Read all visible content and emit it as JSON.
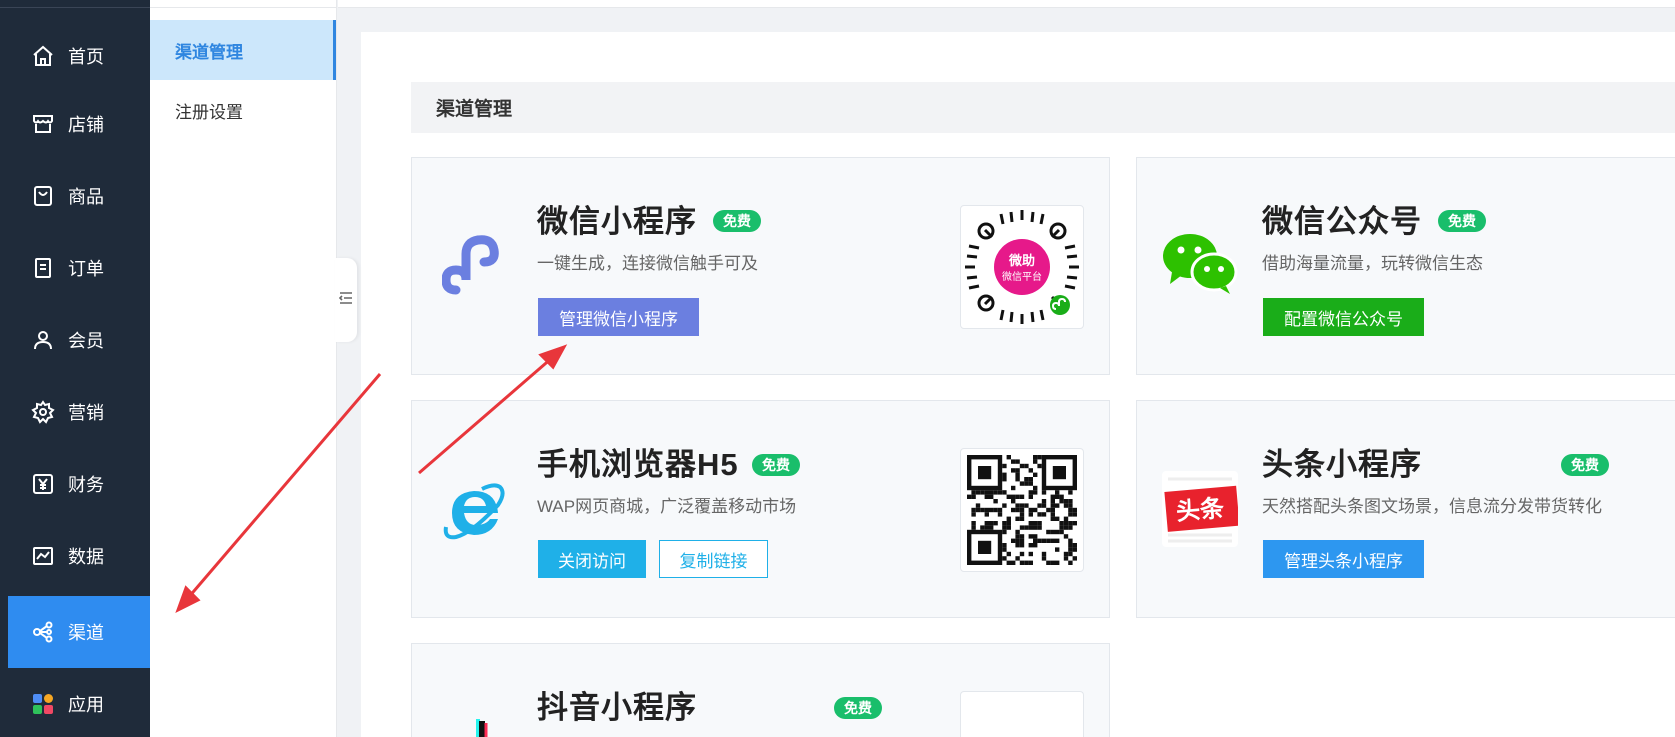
{
  "nav": {
    "items": [
      {
        "label": "首页",
        "icon": "home-icon"
      },
      {
        "label": "店铺",
        "icon": "store-icon"
      },
      {
        "label": "商品",
        "icon": "bag-icon"
      },
      {
        "label": "订单",
        "icon": "order-icon"
      },
      {
        "label": "会员",
        "icon": "user-icon"
      },
      {
        "label": "营销",
        "icon": "gear-icon"
      },
      {
        "label": "财务",
        "icon": "yen-icon"
      },
      {
        "label": "数据",
        "icon": "chart-icon"
      },
      {
        "label": "渠道",
        "icon": "share-icon"
      },
      {
        "label": "应用",
        "icon": "apps-icon"
      }
    ],
    "active": "渠道"
  },
  "subnav": {
    "items": [
      {
        "label": "渠道管理"
      },
      {
        "label": "注册设置"
      }
    ],
    "active": "渠道管理"
  },
  "section": {
    "title": "渠道管理"
  },
  "channels": [
    {
      "title": "微信小程序",
      "badge": "免费",
      "desc": "一键生成，连接微信触手可及",
      "buttons": [
        "管理微信小程序"
      ],
      "qr_text": [
        "微助",
        "微信平台"
      ]
    },
    {
      "title": "微信公众号",
      "badge": "免费",
      "desc": "借助海量流量，玩转微信生态",
      "buttons": [
        "配置微信公众号"
      ]
    },
    {
      "title": "手机浏览器H5",
      "badge": "免费",
      "desc": "WAP网页商城，广泛覆盖移动市场",
      "buttons": [
        "关闭访问",
        "复制链接"
      ]
    },
    {
      "title": "头条小程序",
      "badge": "免费",
      "desc": "天然搭配头条图文场景，信息流分发带货转化",
      "buttons": [
        "管理头条小程序"
      ],
      "logo_text": "头条"
    },
    {
      "title": "抖音小程序",
      "badge": "免费"
    }
  ],
  "colors": {
    "nav_bg": "#1f2b3a",
    "nav_active": "#2f8cf0",
    "badge_green": "#19be6b",
    "wx_mini_btn": "#6b7fe0",
    "wx_pub_btn": "#1aad19",
    "h5_btn": "#1fb0e8",
    "toutiao_btn": "#2d97f0",
    "annotation_red": "#e8363b"
  }
}
